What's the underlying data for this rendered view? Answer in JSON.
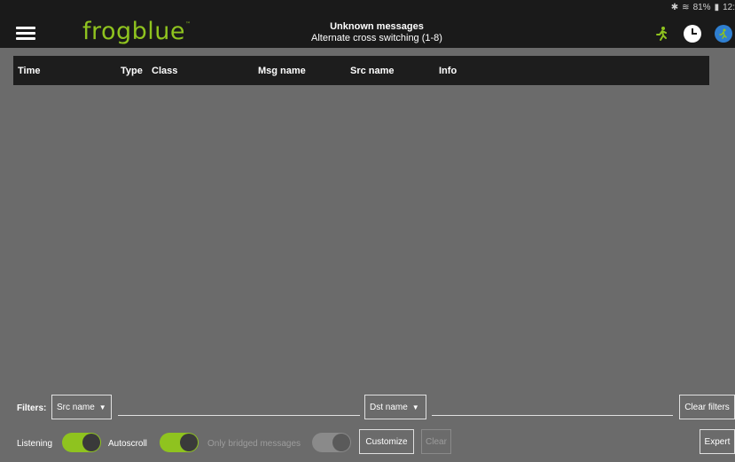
{
  "status": {
    "bluetooth": "✱",
    "wifi": "≋",
    "battery": "81%",
    "battery_icon": "▮",
    "time": "12:"
  },
  "header": {
    "logo": "frogblue",
    "logo_tm": "™",
    "title": "Unknown messages",
    "subtitle": "Alternate cross switching (1-8)",
    "accent_color": "#8fc31f"
  },
  "table": {
    "columns": [
      "Time",
      "Type",
      "Class",
      "Msg name",
      "Src name",
      "Info"
    ],
    "rows": []
  },
  "filters": {
    "label": "Filters:",
    "src_dropdown": "Src name",
    "dst_dropdown": "Dst name",
    "clear_filters": "Clear filters"
  },
  "controls": {
    "listening_label": "Listening",
    "listening_on": true,
    "autoscroll_label": "Autoscroll",
    "autoscroll_on": true,
    "bridged_label": "Only bridged messages",
    "bridged_on": false,
    "customize": "Customize",
    "clear": "Clear",
    "expert": "Expert"
  }
}
